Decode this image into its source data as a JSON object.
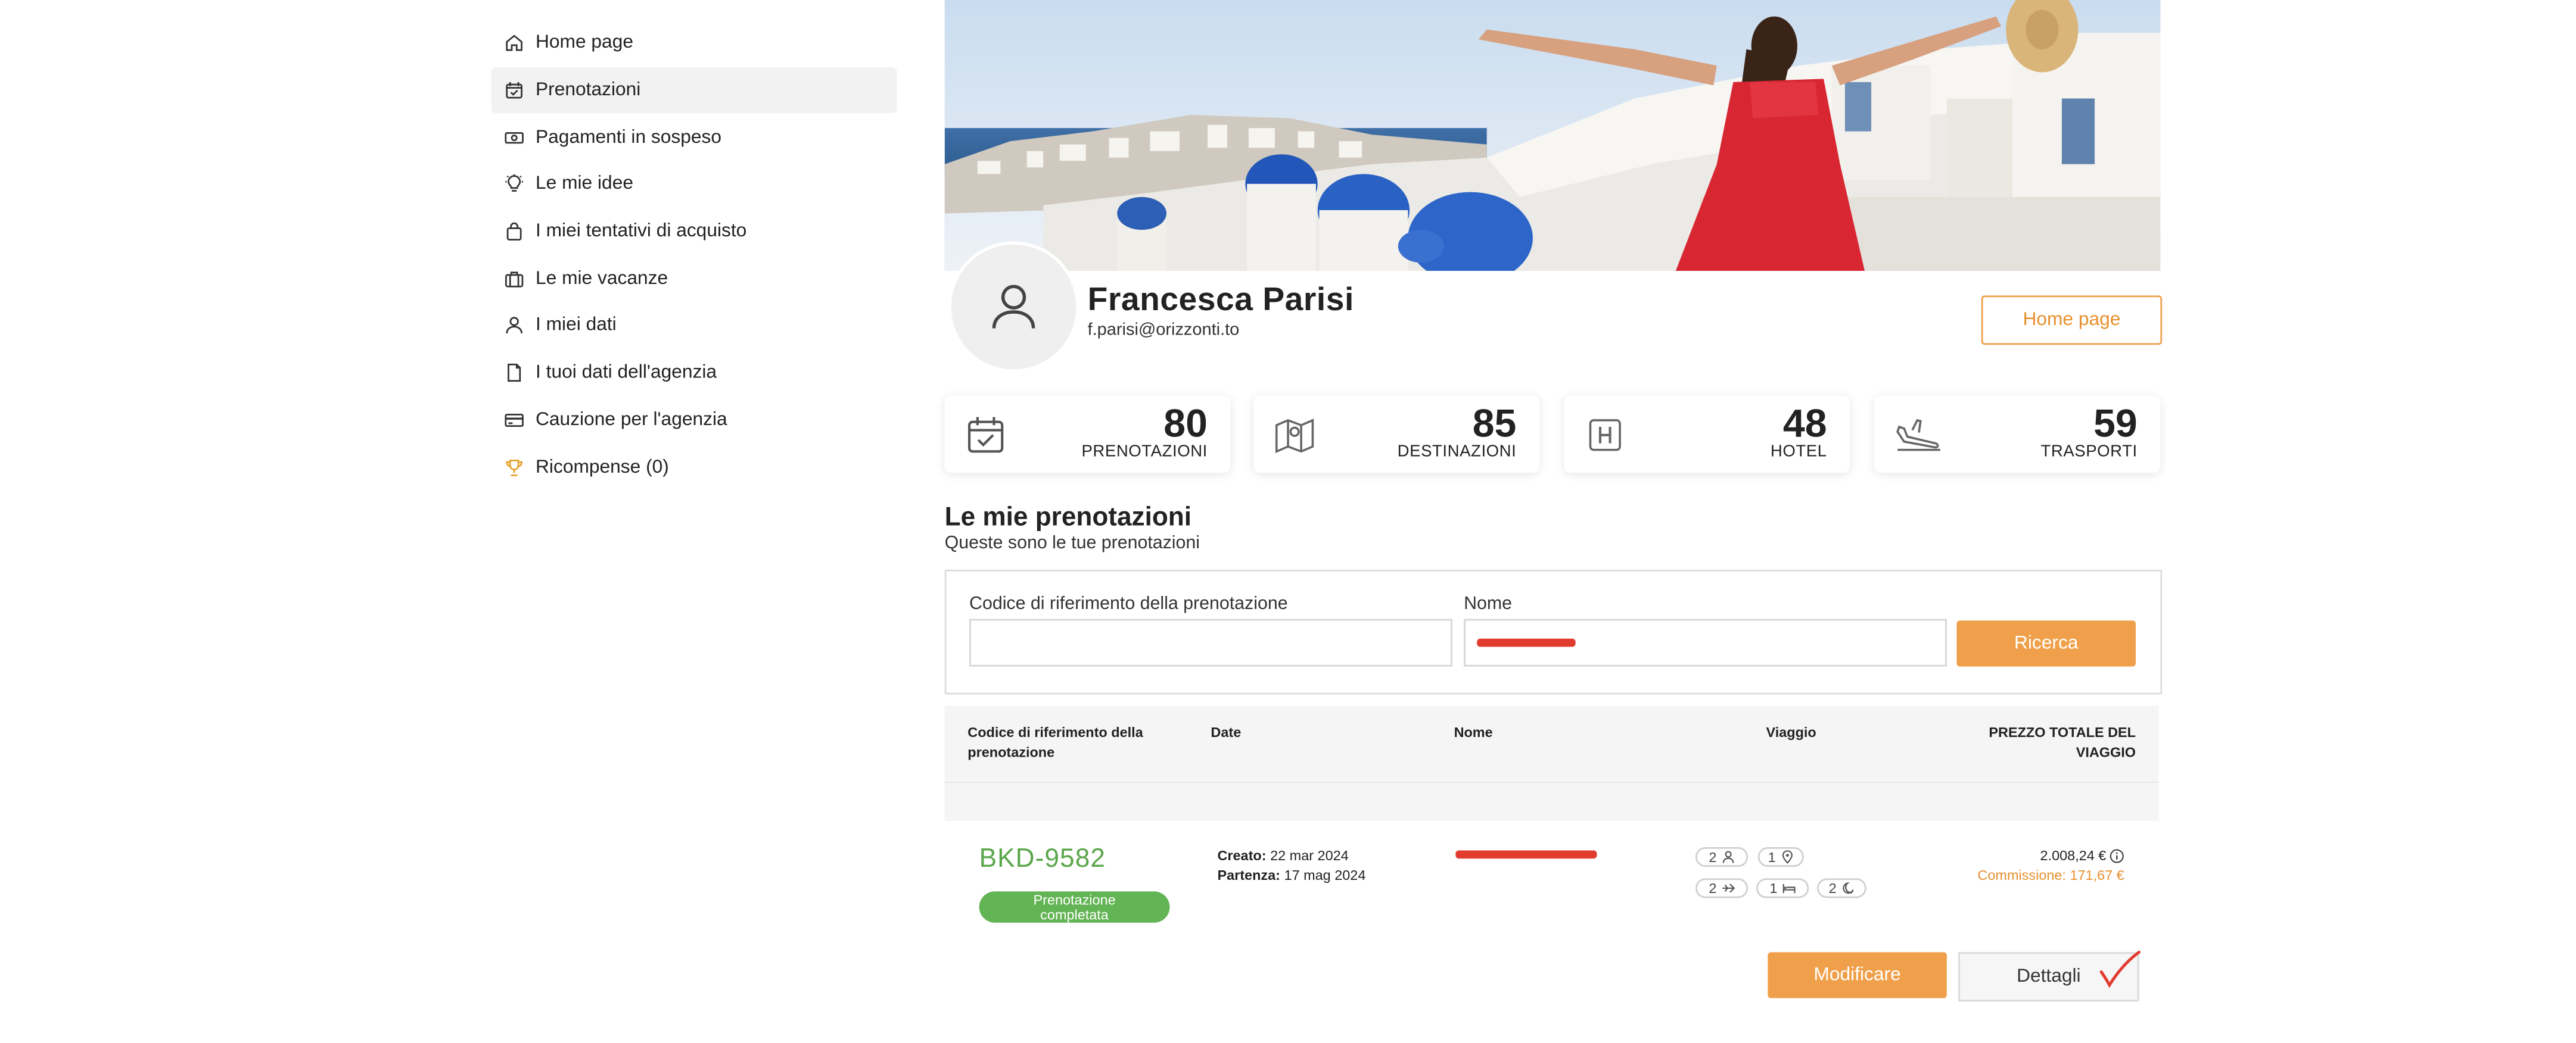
{
  "sidebar": {
    "items": [
      {
        "label": "Home page",
        "icon": "home-icon"
      },
      {
        "label": "Prenotazioni",
        "icon": "calendar-check-icon",
        "active": true
      },
      {
        "label": "Pagamenti in sospeso",
        "icon": "money-icon"
      },
      {
        "label": "Le mie idee",
        "icon": "lightbulb-icon"
      },
      {
        "label": "I miei tentativi di acquisto",
        "icon": "shopping-bag-icon"
      },
      {
        "label": "Le mie vacanze",
        "icon": "suitcase-icon"
      },
      {
        "label": "I miei dati",
        "icon": "user-icon"
      },
      {
        "label": "I tuoi dati dell'agenzia",
        "icon": "document-icon"
      },
      {
        "label": "Cauzione per l'agenzia",
        "icon": "credit-card-icon"
      },
      {
        "label": "Ricompense (0)",
        "icon": "trophy-icon"
      }
    ]
  },
  "profile": {
    "name": "Francesca Parisi",
    "email": "f.parisi@orizzonti.to",
    "home_button": "Home page"
  },
  "stats": [
    {
      "value": "80",
      "label": "PRENOTAZIONI",
      "icon": "calendar-check-icon"
    },
    {
      "value": "85",
      "label": "DESTINAZIONI",
      "icon": "map-icon"
    },
    {
      "value": "48",
      "label": "HOTEL",
      "icon": "hotel-icon"
    },
    {
      "value": "59",
      "label": "TRASPORTI",
      "icon": "plane-landing-icon"
    }
  ],
  "bookings": {
    "title": "Le mie prenotazioni",
    "subtitle": "Queste sono le tue prenotazioni",
    "search": {
      "code_label": "Codice di riferimento della prenotazione",
      "code_value": "",
      "name_label": "Nome",
      "button": "Ricerca"
    },
    "table": {
      "headers": {
        "code": "Codice di riferimento della prenotazione",
        "date": "Date",
        "name": "Nome",
        "trip": "Viaggio",
        "price": "PREZZO TOTALE DEL VIAGGIO"
      },
      "rows": [
        {
          "code": "BKD-9582",
          "status": "Prenotazione completata",
          "created_label": "Creato:",
          "created": "22 mar 2024",
          "departure_label": "Partenza:",
          "departure": "17 mag 2024",
          "chips": {
            "travellers": "2",
            "destinations": "1",
            "transports": "2",
            "rooms": "1",
            "nights": "2"
          },
          "price": "2.008,24 €",
          "commission": "Commissione: 171,67 €",
          "edit_button": "Modificare",
          "details_button": "Dettagli"
        }
      ]
    }
  },
  "colors": {
    "accent": "#f0a04a",
    "success": "#63b454",
    "code_green": "#5aa64a",
    "redaction": "#e23b2f"
  }
}
